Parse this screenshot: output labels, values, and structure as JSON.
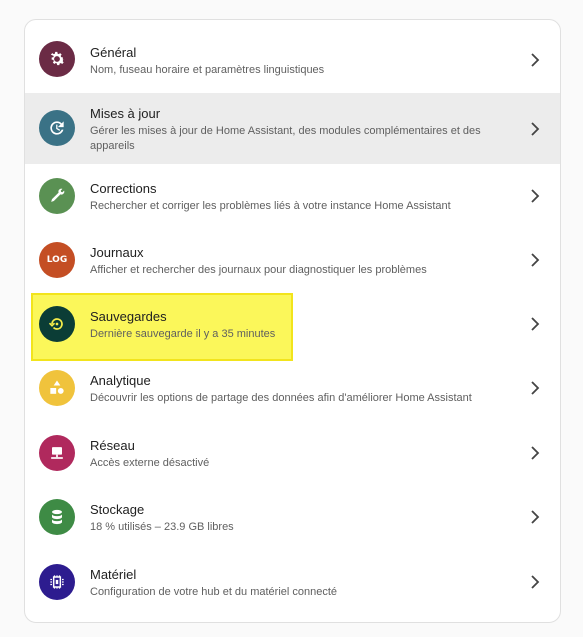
{
  "settings": {
    "items": [
      {
        "title": "Général",
        "subtitle": "Nom, fuseau horaire et paramètres linguistiques",
        "icon": "gear-icon",
        "color": "#6b2b45"
      },
      {
        "title": "Mises à jour",
        "subtitle": "Gérer les mises à jour de Home Assistant, des modules complémentaires et des appareils",
        "icon": "update-icon",
        "color": "#3a7286"
      },
      {
        "title": "Corrections",
        "subtitle": "Rechercher et corriger les problèmes liés à votre instance Home Assistant",
        "icon": "wrench-icon",
        "color": "#5a9153"
      },
      {
        "title": "Journaux",
        "subtitle": "Afficher et rechercher des journaux pour diagnostiquer les problèmes",
        "icon": "log-icon",
        "icon_text": "LOG",
        "color": "#c44e24"
      },
      {
        "title": "Sauvegardes",
        "subtitle": "Dernière sauvegarde il y a 35 minutes",
        "icon": "backup-restore-icon",
        "color": "#0b3d36"
      },
      {
        "title": "Analytique",
        "subtitle": "Découvrir les options de partage des données afin d'améliorer Home Assistant",
        "icon": "shapes-icon",
        "color": "#f0c33c"
      },
      {
        "title": "Réseau",
        "subtitle": "Accès externe désactivé",
        "icon": "network-icon",
        "color": "#b0295d"
      },
      {
        "title": "Stockage",
        "subtitle": "18 % utilisés – 23.9 GB libres",
        "icon": "database-icon",
        "color": "#3e8b45"
      },
      {
        "title": "Matériel",
        "subtitle": "Configuration de votre hub et du matériel connecté",
        "icon": "chip-icon",
        "color": "#2d1c8f"
      }
    ]
  },
  "colors": {
    "highlight": "#fbf75a",
    "hover_row": "#ececec"
  }
}
